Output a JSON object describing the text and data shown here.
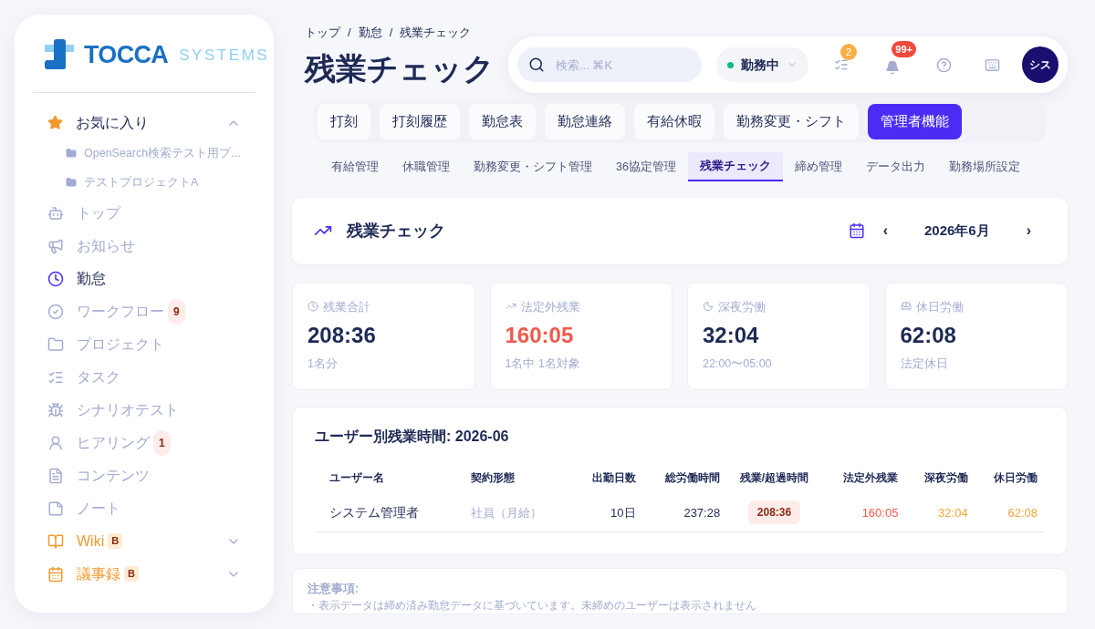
{
  "sidebar": {
    "logo": {
      "brand": "TOCCA",
      "sub": "SYSTEMS"
    },
    "favorites": {
      "label": "お気に入り",
      "expanded": true,
      "children": [
        {
          "label": "OpenSearch検索テスト用プ..."
        },
        {
          "label": "テストプロジェクトA"
        }
      ]
    },
    "items": [
      {
        "label": "トップ",
        "selected": false,
        "kind": "nav"
      },
      {
        "label": "お知らせ",
        "selected": false,
        "kind": "nav"
      },
      {
        "label": "勤怠",
        "selected": true,
        "kind": "nav"
      },
      {
        "label": "ワークフロー",
        "selected": false,
        "kind": "nav",
        "badge": "9"
      },
      {
        "label": "プロジェクト",
        "selected": false,
        "kind": "nav"
      },
      {
        "label": "タスク",
        "selected": false,
        "kind": "nav"
      },
      {
        "label": "シナリオテスト",
        "selected": false,
        "kind": "nav"
      },
      {
        "label": "ヒアリング",
        "selected": false,
        "kind": "nav",
        "badge": "1"
      },
      {
        "label": "コンテンツ",
        "selected": false,
        "kind": "nav"
      },
      {
        "label": "ノート",
        "selected": false,
        "kind": "nav"
      },
      {
        "label": "Wiki",
        "selected": false,
        "kind": "group",
        "badge": "B",
        "expanded": false
      },
      {
        "label": "議事録",
        "selected": false,
        "kind": "group",
        "badge": "B",
        "expanded": false
      }
    ]
  },
  "header": {
    "breadcrumb": [
      "トップ",
      "勤怠",
      "残業チェック"
    ],
    "breadcrumb_separator": "/",
    "title": "残業チェック",
    "search": {
      "placeholder": "検索... ⌘K"
    },
    "status": {
      "label": "勤務中",
      "on": true
    },
    "tasks_badge": "2",
    "notifications_badge": "99+",
    "avatar": "シス"
  },
  "tabs": [
    {
      "label": "打刻",
      "selected": false
    },
    {
      "label": "打刻履歴",
      "selected": false
    },
    {
      "label": "勤怠表",
      "selected": false
    },
    {
      "label": "勤怠連絡",
      "selected": false
    },
    {
      "label": "有給休暇",
      "selected": false
    },
    {
      "label": "勤務変更・シフト",
      "selected": false
    },
    {
      "label": "管理者機能",
      "selected": true
    }
  ],
  "sub_tabs": [
    {
      "label": "有給管理",
      "selected": false
    },
    {
      "label": "休職管理",
      "selected": false
    },
    {
      "label": "勤務変更・シフト管理",
      "selected": false
    },
    {
      "label": "36協定管理",
      "selected": false
    },
    {
      "label": "残業チェック",
      "selected": true
    },
    {
      "label": "締め管理",
      "selected": false
    },
    {
      "label": "データ出力",
      "selected": false
    },
    {
      "label": "勤務場所設定",
      "selected": false
    }
  ],
  "section": {
    "title": "残業チェック",
    "month": "2026年6月",
    "prev": "‹",
    "next": "›"
  },
  "stats": [
    {
      "label": "残業合計",
      "value": "208:36",
      "note": "1名分",
      "alert": false
    },
    {
      "label": "法定外残業",
      "value": "160:05",
      "note": "1名中 1名対象",
      "alert": true
    },
    {
      "label": "深夜労働",
      "value": "32:04",
      "note": "22:00〜05:00",
      "alert": false
    },
    {
      "label": "休日労働",
      "value": "62:08",
      "note": "法定休日",
      "alert": false
    }
  ],
  "table": {
    "title": "ユーザー別残業時間: 2026-06",
    "columns": [
      "ユーザー名",
      "契約形態",
      "出勤日数",
      "総労働時間",
      "残業/超過時間",
      "法定外残業",
      "深夜労働",
      "休日労働"
    ],
    "rows": [
      [
        "システム管理者",
        "社員（月給）",
        "10日",
        "237:28",
        "208:36",
        "160:05",
        "32:04",
        "62:08"
      ]
    ]
  },
  "notes": {
    "title": "注意事項:",
    "items": [
      "・表示データは締め済み勤怠データに基づいています。未締めのユーザーは表示されません"
    ]
  }
}
